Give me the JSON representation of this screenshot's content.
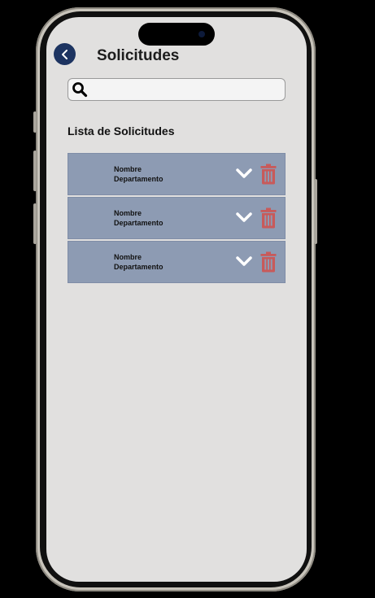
{
  "header": {
    "title": "Solicitudes"
  },
  "search": {
    "placeholder": "",
    "value": ""
  },
  "section": {
    "title": "Lista de Solicitudes"
  },
  "requests": [
    {
      "name": "Nombre",
      "department": "Departamento"
    },
    {
      "name": "Nombre",
      "department": "Departamento"
    },
    {
      "name": "Nombre",
      "department": "Departamento"
    }
  ],
  "icons": {
    "back": "chevron-left-icon",
    "search": "search-icon",
    "expand": "chevron-down-icon",
    "delete": "trash-icon"
  },
  "colors": {
    "primary": "#1d3461",
    "item_background": "#8d9bb3",
    "delete": "#c85a5a",
    "screen_background": "#e1e0df"
  }
}
